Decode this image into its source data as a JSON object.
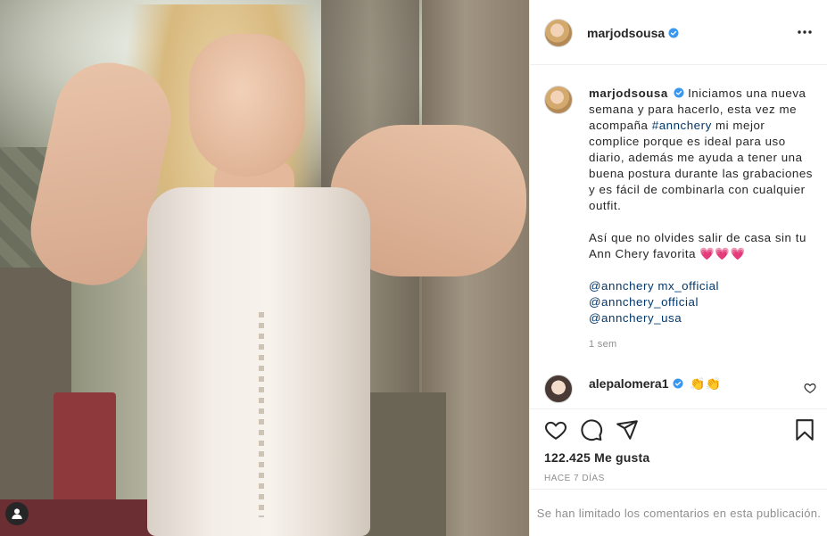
{
  "post": {
    "author": "marjodsousa",
    "caption": {
      "line1": "Iniciamos una nueva semana y para hacerlo, esta vez me acompaña ",
      "hashtag": "#annchery",
      "line1_rest": " mi mejor complice porque es ideal para uso diario, además me ayuda a tener una buena postura durante las grabaciones y es fácil de combinarla con cualquier outfit.",
      "para2": "Así que no olvides salir de casa sin tu Ann Chery favorita 💗💗💗",
      "mentions": [
        "@annchery mx_official",
        "@annchery_official",
        "@annchery_usa"
      ]
    },
    "caption_time": "1 sem",
    "comment": {
      "author": "alepalomera1",
      "text": "👏👏"
    },
    "likes": "122.425 Me gusta",
    "date": "HACE 7 DÍAS",
    "comments_limited": "Se han limitado los comentarios en esta publicación."
  },
  "icons": {
    "like": "heart-icon",
    "comment": "comment-icon",
    "share": "share-icon",
    "save": "bookmark-icon",
    "more": "more-options-icon",
    "verified": "verified-badge-icon",
    "user_tags": "user-tag-icon"
  },
  "colors": {
    "link": "#00376b",
    "verified": "#3897f0",
    "muted": "#8e8e8e",
    "text": "#262626"
  }
}
